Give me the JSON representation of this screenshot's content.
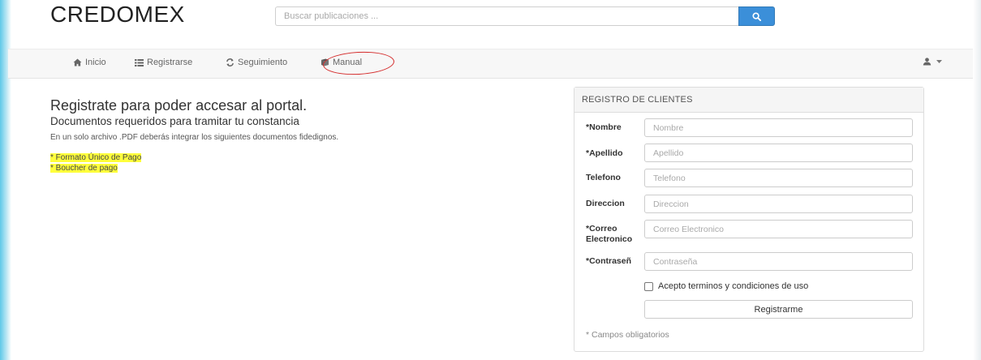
{
  "header": {
    "brand": "CREDOMEX",
    "search_placeholder": "Buscar publicaciones ..."
  },
  "navbar": {
    "items": [
      {
        "label": "Inicio",
        "icon": "home-icon"
      },
      {
        "label": "Registrarse",
        "icon": "list-icon"
      },
      {
        "label": "Seguimiento",
        "icon": "refresh-icon"
      },
      {
        "label": "Manual",
        "icon": "book-icon"
      }
    ],
    "user_icon": "user-icon"
  },
  "intro": {
    "title": "Registrate para poder accesar al portal.",
    "subtitle": "Documentos requeridos para tramitar tu constancia",
    "text": "En un solo archivo .PDF deberás integrar los siguientes documentos fidedignos.",
    "requirements": [
      "* Formato Único de Pago",
      "* Boucher de pago"
    ]
  },
  "register_panel": {
    "heading": "REGISTRO DE CLIENTES",
    "fields": [
      {
        "label": "*Nombre",
        "placeholder": "Nombre"
      },
      {
        "label": "*Apellido",
        "placeholder": "Apellido"
      },
      {
        "label": "Telefono",
        "placeholder": "Telefono"
      },
      {
        "label": "Direccion",
        "placeholder": "Direccion"
      },
      {
        "label": "*Correo Electronico",
        "placeholder": "Correo Electronico"
      },
      {
        "label": "*Contraseñ",
        "placeholder": "Contraseña"
      }
    ],
    "terms_label": "Acepto terminos y condiciones de uso",
    "submit_label": "Registrarme",
    "required_note": "* Campos obligatorios"
  },
  "colors": {
    "primary": "#3b8fd9",
    "annotation_circle": "#d42a2a",
    "highlight": "#ffff3c"
  }
}
